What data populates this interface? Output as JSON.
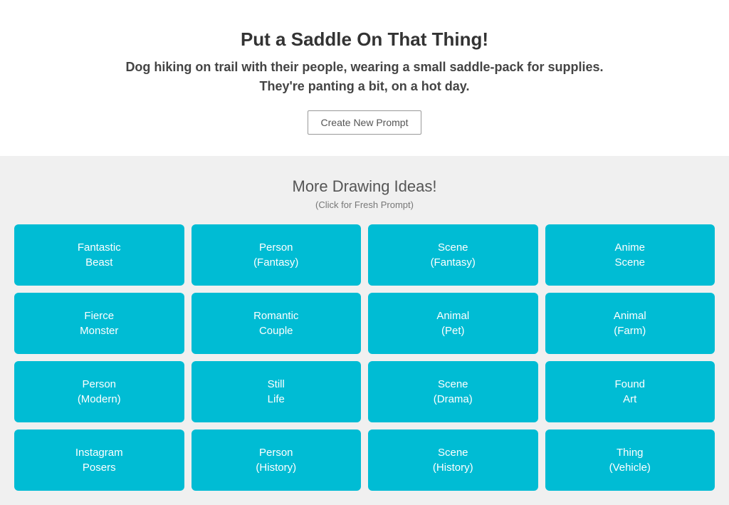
{
  "hero": {
    "title": "Put a Saddle On That Thing!",
    "description_line1": "Dog hiking on trail with their people, wearing a small saddle-pack for supplies.",
    "description_line2": "They're panting a bit, on a hot day.",
    "create_button_label": "Create New Prompt"
  },
  "ideas": {
    "title": "More Drawing Ideas!",
    "subtitle": "(Click for Fresh Prompt)",
    "grid_items": [
      {
        "line1": "Fantastic",
        "line2": "Beast"
      },
      {
        "line1": "Person",
        "line2": "(Fantasy)"
      },
      {
        "line1": "Scene",
        "line2": "(Fantasy)"
      },
      {
        "line1": "Anime",
        "line2": "Scene"
      },
      {
        "line1": "Fierce",
        "line2": "Monster"
      },
      {
        "line1": "Romantic",
        "line2": "Couple"
      },
      {
        "line1": "Animal",
        "line2": "(Pet)"
      },
      {
        "line1": "Animal",
        "line2": "(Farm)"
      },
      {
        "line1": "Person",
        "line2": "(Modern)"
      },
      {
        "line1": "Still",
        "line2": "Life"
      },
      {
        "line1": "Scene",
        "line2": "(Drama)"
      },
      {
        "line1": "Found",
        "line2": "Art"
      },
      {
        "line1": "Instagram",
        "line2": "Posers"
      },
      {
        "line1": "Person",
        "line2": "(History)"
      },
      {
        "line1": "Scene",
        "line2": "(History)"
      },
      {
        "line1": "Thing",
        "line2": "(Vehicle)"
      }
    ]
  }
}
